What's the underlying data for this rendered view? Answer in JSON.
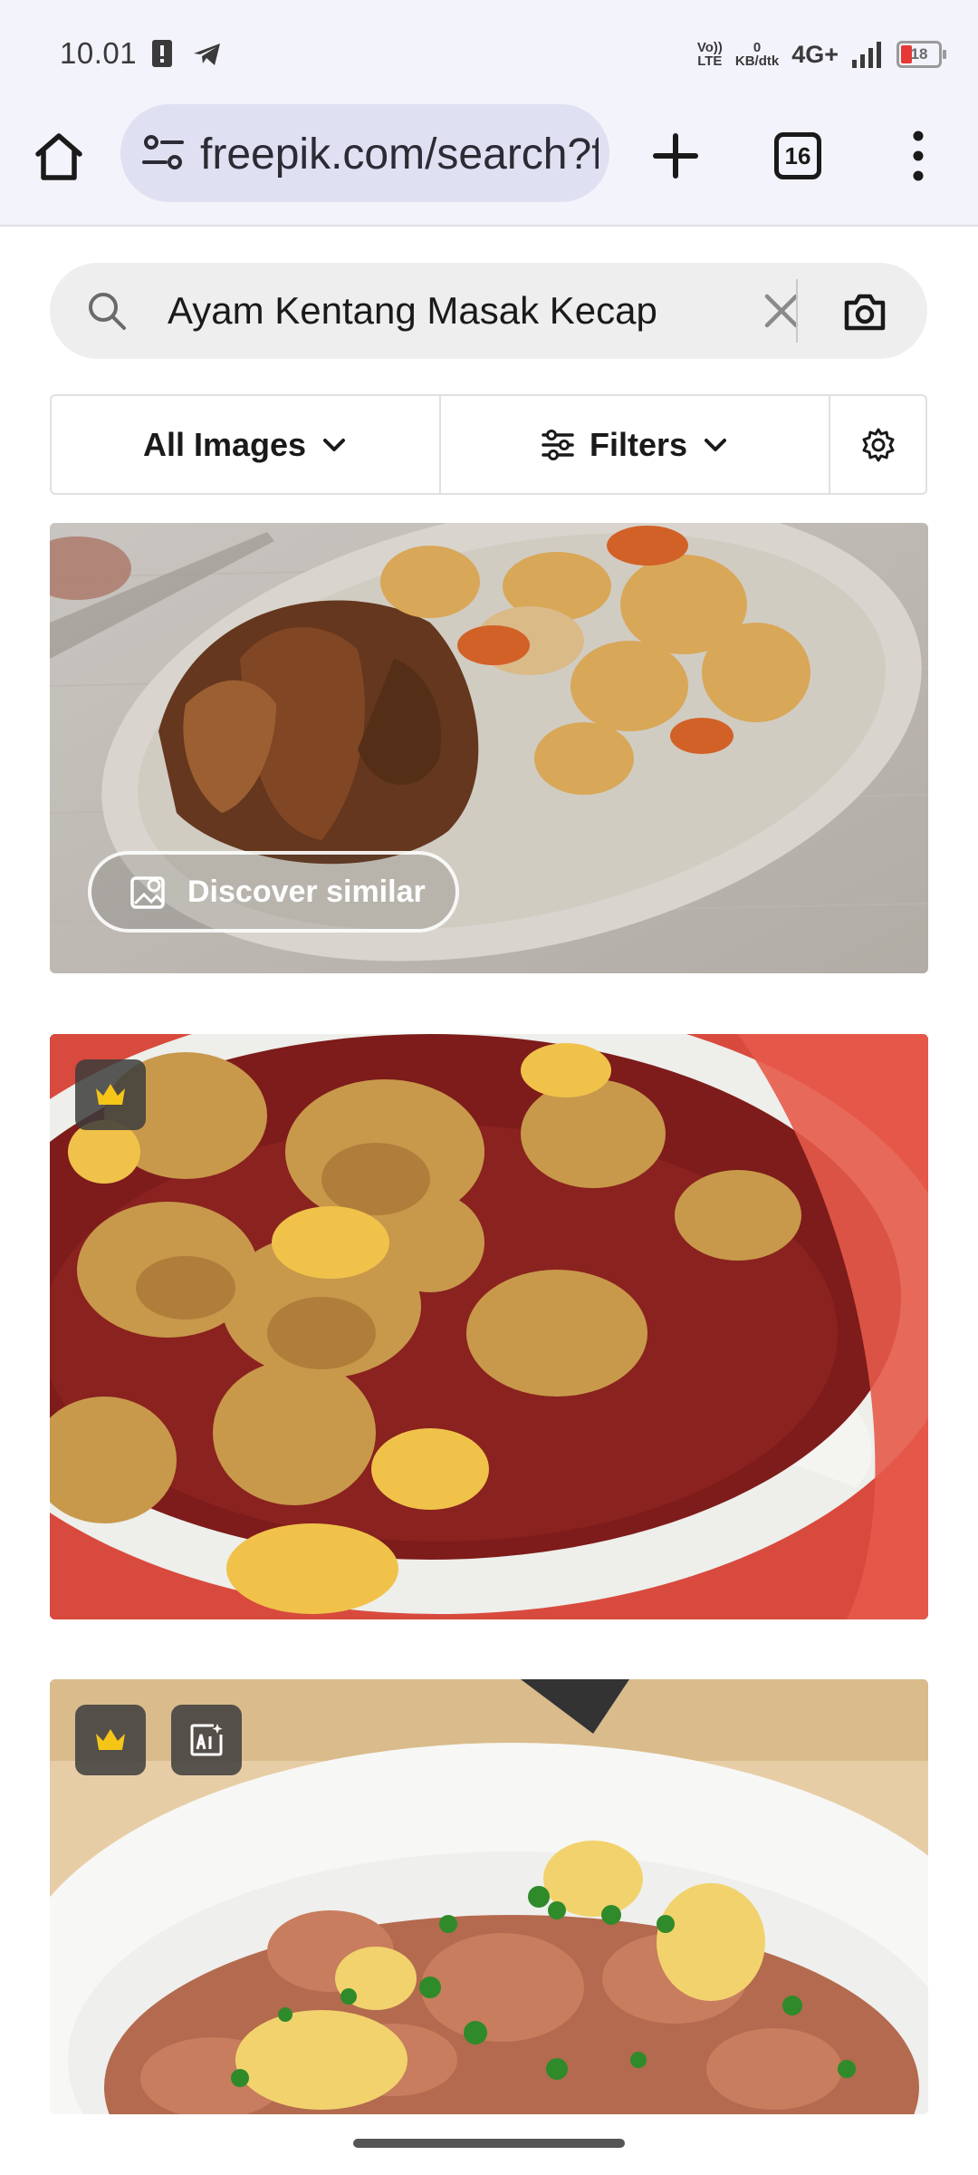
{
  "status_bar": {
    "time": "10.01",
    "volte_top": "Vo))",
    "volte_bottom": "LTE",
    "data_rate_value": "0",
    "data_rate_unit": "KB/dtk",
    "network": "4G+",
    "battery": "18",
    "icons": [
      "alert-icon",
      "telegram-icon",
      "signal-icon",
      "battery-icon"
    ]
  },
  "browser": {
    "url": "freepik.com/search?format",
    "tab_count": "16",
    "icons": [
      "home-icon",
      "site-info-icon",
      "plus-icon",
      "menu-dots-icon"
    ]
  },
  "search": {
    "query": "Ayam Kentang Masak Kecap",
    "icons": [
      "search-icon",
      "close-icon",
      "camera-icon"
    ]
  },
  "filters": {
    "type_label": "All Images",
    "filters_label": "Filters",
    "icons": [
      "chevron-down-icon",
      "sliders-icon",
      "gear-icon"
    ]
  },
  "results": [
    {
      "action": "Discover similar",
      "badges": []
    },
    {
      "badges": [
        "crown-icon"
      ]
    },
    {
      "badges": [
        "crown-icon",
        "ai-icon"
      ]
    }
  ],
  "colors": {
    "premium": "#f5c518",
    "toolbar_bg": "#f3f3fb",
    "url_bg": "#dfe0f1",
    "battery_low": "#e53935"
  }
}
